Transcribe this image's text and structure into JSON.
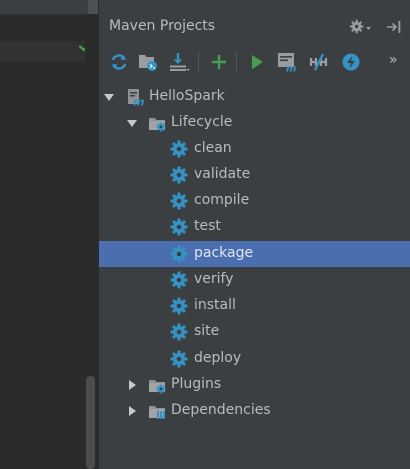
{
  "colors": {
    "panel_bg": "#3c3f41",
    "selection": "#4b6eaf",
    "icon_blue": "#3592c4",
    "run_green": "#499c54",
    "text": "#bbbbbb"
  },
  "editor": {
    "status_icon": "checkmark-icon"
  },
  "panel": {
    "title": "Maven Projects",
    "title_icons": [
      "gear-icon",
      "hide-icon"
    ],
    "toolbar": [
      "reimport-icon",
      "generate-sources-icon",
      "download-icon",
      "add-icon",
      "run-icon",
      "execute-goal-icon",
      "toggle-offline-icon",
      "skip-tests-icon",
      "more-icon"
    ],
    "more_label": "»"
  },
  "tree": {
    "project": {
      "label": "HelloSpark",
      "expanded": true
    },
    "lifecycle": {
      "label": "Lifecycle",
      "expanded": true
    },
    "goals": [
      "clean",
      "validate",
      "compile",
      "test",
      "package",
      "verify",
      "install",
      "site",
      "deploy"
    ],
    "selected_goal": "package",
    "plugins": {
      "label": "Plugins",
      "expanded": false
    },
    "dependencies": {
      "label": "Dependencies",
      "expanded": false
    }
  }
}
